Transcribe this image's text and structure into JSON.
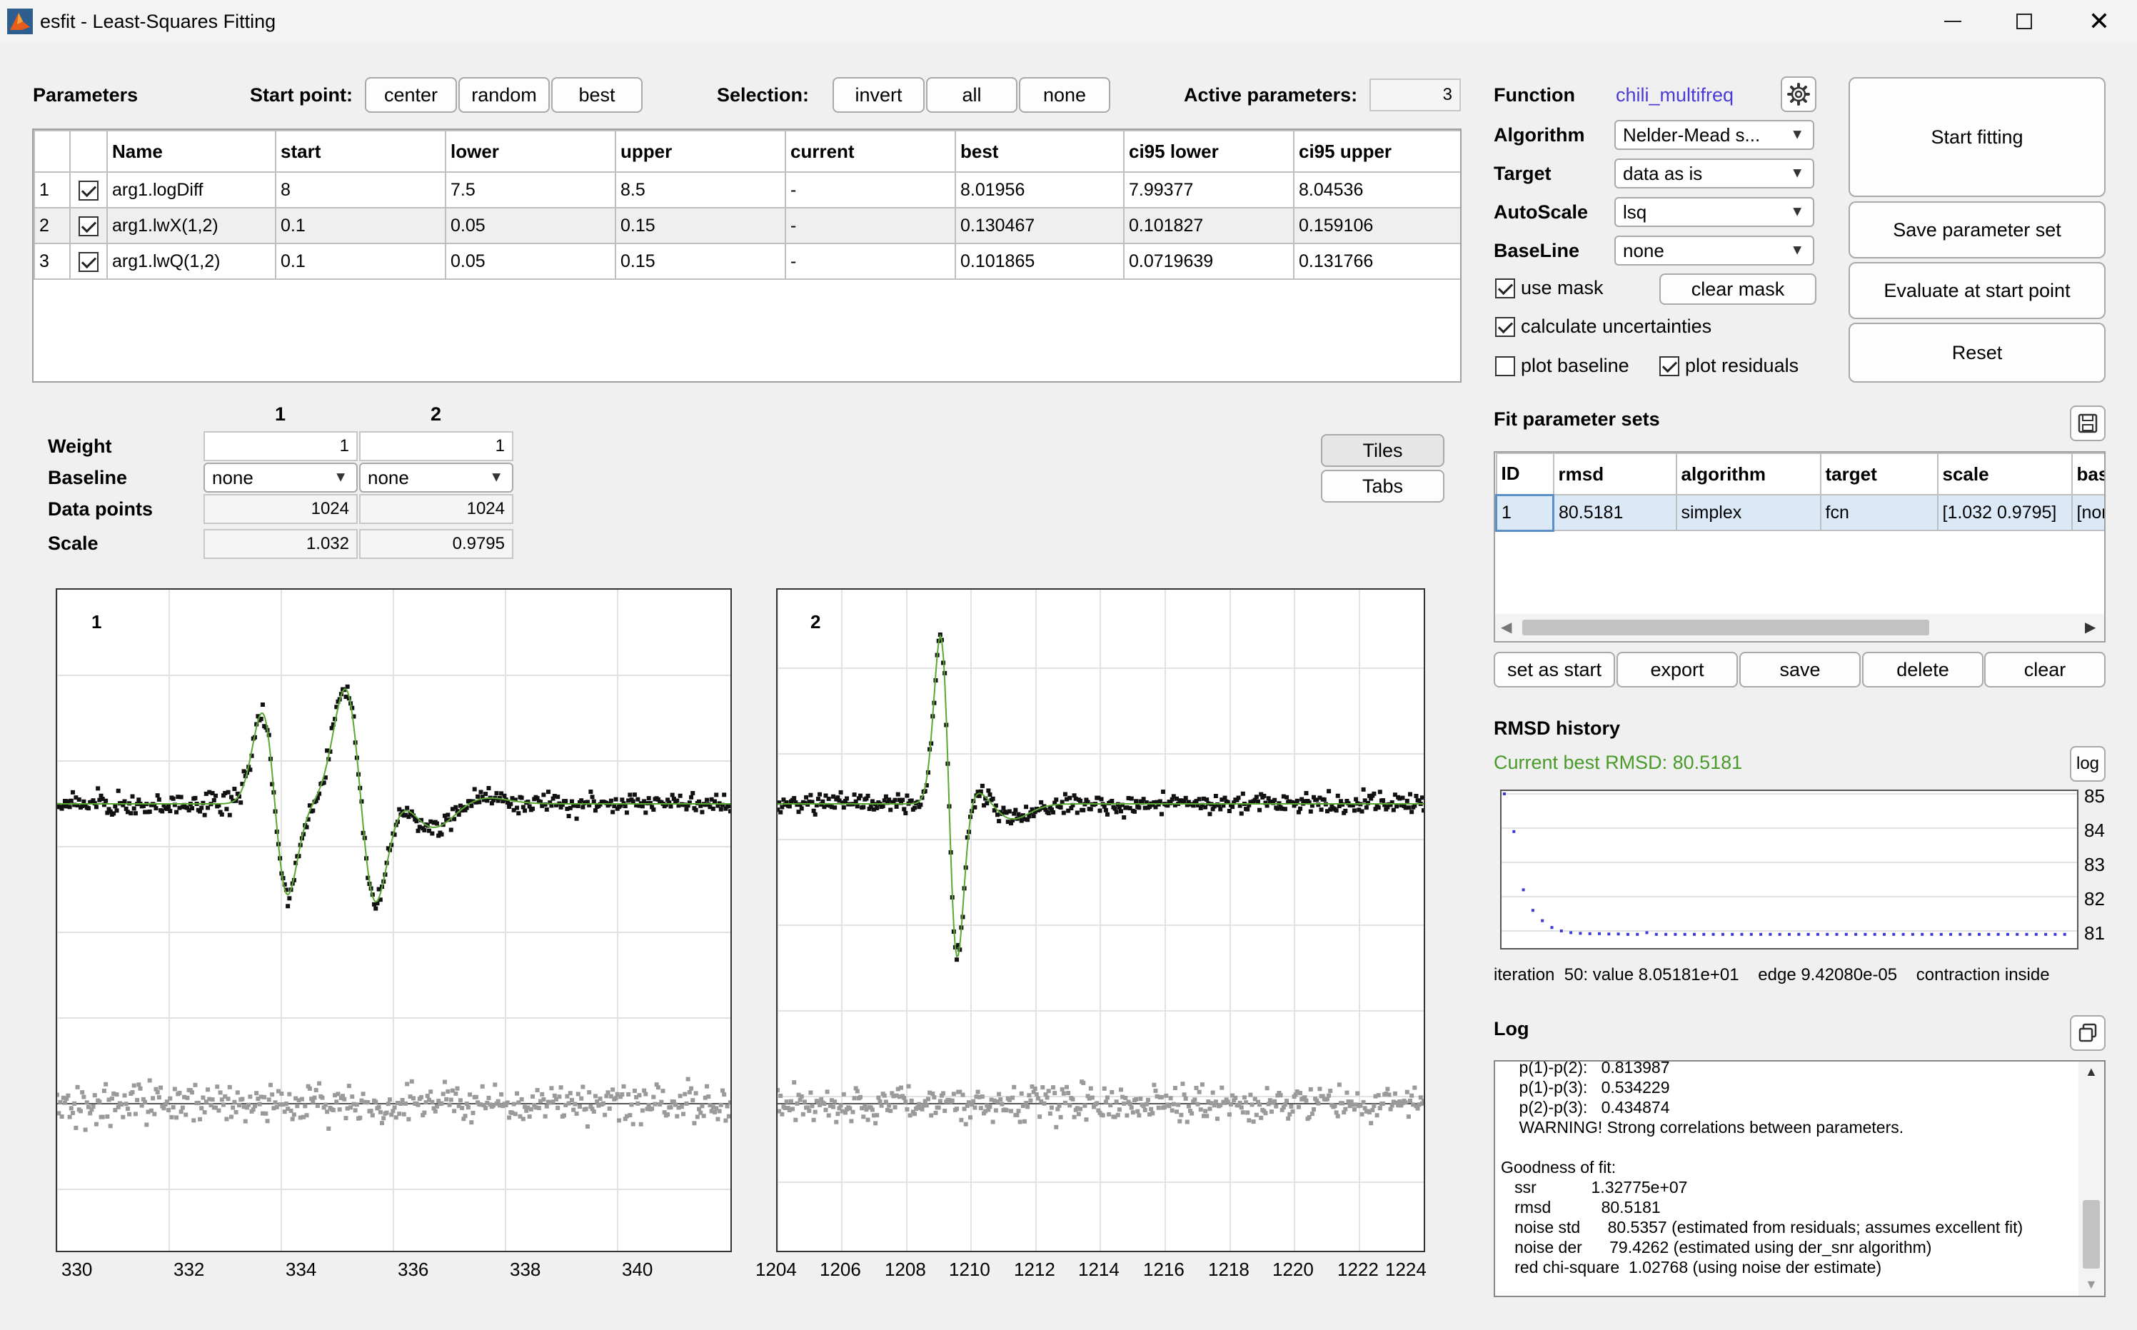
{
  "window": {
    "title": "esfit - Least-Squares Fitting"
  },
  "params_header": {
    "title": "Parameters",
    "start_point_label": "Start point:",
    "start_buttons": [
      "center",
      "random",
      "best"
    ],
    "selection_label": "Selection:",
    "selection_buttons": [
      "invert",
      "all",
      "none"
    ],
    "active_label": "Active parameters:",
    "active_value": "3"
  },
  "params_table": {
    "columns": [
      "",
      "",
      "Name",
      "start",
      "lower",
      "upper",
      "current",
      "best",
      "ci95 lower",
      "ci95 upper"
    ],
    "rows": [
      {
        "idx": "1",
        "checked": true,
        "name": "arg1.logDiff",
        "start": "8",
        "lower": "7.5",
        "upper": "8.5",
        "current": "-",
        "best": "8.01956",
        "ci_lo": "7.99377",
        "ci_hi": "8.04536"
      },
      {
        "idx": "2",
        "checked": true,
        "name": "arg1.lwX(1,2)",
        "start": "0.1",
        "lower": "0.05",
        "upper": "0.15",
        "current": "-",
        "best": "0.130467",
        "ci_lo": "0.101827",
        "ci_hi": "0.159106"
      },
      {
        "idx": "3",
        "checked": true,
        "name": "arg1.lwQ(1,2)",
        "start": "0.1",
        "lower": "0.05",
        "upper": "0.15",
        "current": "-",
        "best": "0.101865",
        "ci_lo": "0.0719639",
        "ci_hi": "0.131766"
      }
    ]
  },
  "datasets": {
    "col_headers": [
      "1",
      "2"
    ],
    "weight_label": "Weight",
    "weights": [
      "1",
      "1"
    ],
    "baseline_label": "Baseline",
    "baselines": [
      "none",
      "none"
    ],
    "points_label": "Data points",
    "points": [
      "1024",
      "1024"
    ],
    "scale_label": "Scale",
    "scales": [
      "1.032",
      "0.9795"
    ],
    "tiles_label": "Tiles",
    "tabs_label": "Tabs"
  },
  "plots": {
    "p1": {
      "label": "1",
      "ticks": [
        "330",
        "332",
        "334",
        "336",
        "338",
        "340"
      ]
    },
    "p2": {
      "label": "2",
      "ticks": [
        "1204",
        "1206",
        "1208",
        "1210",
        "1212",
        "1214",
        "1216",
        "1218",
        "1220",
        "1222",
        "1224"
      ]
    }
  },
  "settings": {
    "function_label": "Function",
    "function_value": "chili_multifreq",
    "algorithm_label": "Algorithm",
    "algorithm_value": "Nelder-Mead s...",
    "target_label": "Target",
    "target_value": "data as is",
    "autoscale_label": "AutoScale",
    "autoscale_value": "lsq",
    "baseline_label": "BaseLine",
    "baseline_value": "none",
    "use_mask": "use mask",
    "clear_mask": "clear mask",
    "calc_unc": "calculate uncertainties",
    "plot_baseline": "plot baseline",
    "plot_residuals": "plot residuals"
  },
  "actions": {
    "start": "Start fitting",
    "save": "Save parameter set",
    "evaluate": "Evaluate at start point",
    "reset": "Reset"
  },
  "fitsets": {
    "title": "Fit parameter sets",
    "columns": [
      "ID",
      "rmsd",
      "algorithm",
      "target",
      "scale",
      "bas"
    ],
    "rows": [
      {
        "id": "1",
        "rmsd": "80.5181",
        "algorithm": "simplex",
        "target": "fcn",
        "scale": "[1.032 0.9795]",
        "bas": "[nor"
      }
    ],
    "buttons": [
      "set as start",
      "export",
      "save",
      "delete",
      "clear"
    ]
  },
  "rmsd": {
    "title": "RMSD history",
    "current": "Current best RMSD: 80.5181",
    "log_button": "log",
    "yticks": [
      "85",
      "84",
      "83",
      "82",
      "81"
    ],
    "status": "iteration  50: value 8.05181e+01    edge 9.42080e-05    contraction inside",
    "points": [
      85.1,
      84.0,
      82.3,
      81.7,
      81.4,
      81.2,
      81.1,
      81.05,
      81.03,
      81.02,
      81.02,
      81.01,
      81.01,
      81.0,
      81.0,
      81.05,
      81.0,
      81.0
    ]
  },
  "log": {
    "title": "Log",
    "lines": [
      "    p(1)-p(2):   0.813987",
      "    p(1)-p(3):   0.534229",
      "    p(2)-p(3):   0.434874",
      "    WARNING! Strong correlations between parameters.",
      "",
      "Goodness of fit:",
      "   ssr            1.32775e+07",
      "   rmsd           80.5181",
      "   noise std      80.5357 (estimated from residuals; assumes excellent fit)",
      "   noise der      79.4262 (estimated using der_snr algorithm)",
      "   red chi-square  1.02768 (using noise der estimate)"
    ]
  },
  "colors": {
    "accent_link": "#4a3bd6",
    "rmsd_green": "#4a9a2a",
    "fit_line": "#5aa832",
    "residual_gray": "#9a9a9a",
    "selected_row": "#dbe9f7"
  }
}
